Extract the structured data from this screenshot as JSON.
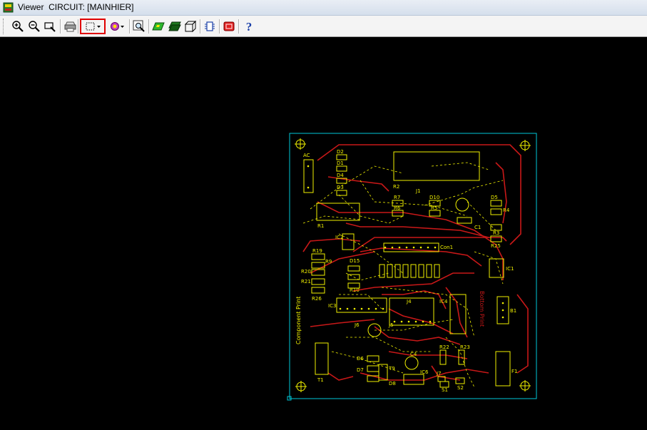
{
  "window": {
    "title": "Viewer  CIRCUIT: [MAINHIER]"
  },
  "toolbar": {
    "buttons": [
      {
        "name": "zoom-in",
        "icon": "zoom-in-icon"
      },
      {
        "name": "zoom-out",
        "icon": "zoom-out-icon"
      },
      {
        "name": "zoom-window",
        "icon": "zoom-window-icon"
      },
      {
        "name": "print",
        "icon": "printer-icon"
      },
      {
        "name": "select-mode",
        "icon": "selection-rectangle-icon",
        "selected": true
      },
      {
        "name": "color-layers",
        "icon": "color-palette-icon"
      },
      {
        "name": "zoom-fit",
        "icon": "zoom-fit-icon"
      },
      {
        "name": "layer-top",
        "icon": "layer-green-icon"
      },
      {
        "name": "layer-bottom",
        "icon": "layer-dark-green-icon"
      },
      {
        "name": "3d-view",
        "icon": "3d-box-icon"
      },
      {
        "name": "component-view",
        "icon": "component-icon"
      },
      {
        "name": "stop",
        "icon": "stop-red-icon"
      },
      {
        "name": "help",
        "icon": "help-icon",
        "label": "?"
      }
    ],
    "selection_color": "#e00000"
  },
  "board": {
    "outline_color": "#00c8d8",
    "track_color": "#c81818",
    "silkscreen_color": "#f0f000",
    "ratsnest_color": "#f0f000",
    "pad_color": "#f0f000",
    "side_label": "Component Print",
    "side_label_2": "Bottom Print",
    "components": {
      "ac": "AC",
      "d2": "D2",
      "d1": "D1",
      "d4": "D4",
      "d3": "D3",
      "r2_main": "R2",
      "j1": "J1",
      "r7": "R7",
      "d10": "D10",
      "d5": "D5",
      "r4": "R4",
      "r5": "R5",
      "r6": "R6",
      "c1": "C1",
      "r3": "R3",
      "r1": "R1",
      "r25": "R25",
      "ic2": "IC2",
      "con1": "Con1",
      "r19": "R19",
      "r9": "R9",
      "r20": "R20",
      "r21": "R21",
      "r26": "R26",
      "d15": "D15",
      "r10": "R10",
      "ic1": "IC1",
      "ic3": "IC3",
      "j4": "J4",
      "ic4": "IC4",
      "j6": "J6",
      "j5": "J5",
      "b1": "B1",
      "c4": "C4",
      "ic6": "IC6",
      "j7": "J7",
      "s1": "S1",
      "s2": "S2",
      "d6": "D6",
      "d7": "D7",
      "t9": "T9",
      "d8": "D8",
      "f1": "F1",
      "r22": "R22",
      "r23": "R23",
      "t1": "T1"
    }
  }
}
